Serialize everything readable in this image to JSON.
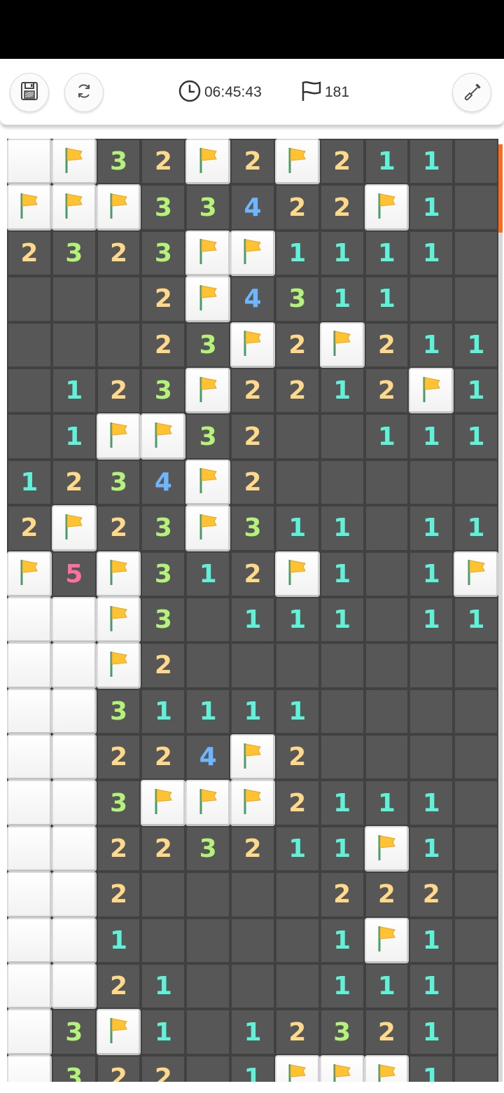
{
  "toolbar": {
    "timer": "06:45:43",
    "flags_remaining": "181",
    "icons": {
      "save": "floppy-disk-icon",
      "restart": "refresh-icon",
      "dig": "shovel-icon",
      "timer": "clock-icon",
      "flags": "flag-outline-icon"
    }
  },
  "board": {
    "legend": "C = covered, F = flagged, . = revealed empty, 1-5 = revealed number",
    "rows": [
      [
        "C",
        "F",
        "3",
        "2",
        "F",
        "2",
        "F",
        "2",
        "1",
        "1",
        "."
      ],
      [
        "F",
        "F",
        "F",
        "3",
        "3",
        "4",
        "2",
        "2",
        "F",
        "1",
        "."
      ],
      [
        "2",
        "3",
        "2",
        "3",
        "F",
        "F",
        "1",
        "1",
        "1",
        "1",
        "."
      ],
      [
        ".",
        ".",
        ".",
        "2",
        "F",
        "4",
        "3",
        "1",
        "1",
        ".",
        "."
      ],
      [
        ".",
        ".",
        ".",
        "2",
        "3",
        "F",
        "2",
        "F",
        "2",
        "1",
        "1"
      ],
      [
        ".",
        "1",
        "2",
        "3",
        "F",
        "2",
        "2",
        "1",
        "2",
        "F",
        "1"
      ],
      [
        ".",
        "1",
        "F",
        "F",
        "3",
        "2",
        ".",
        ".",
        "1",
        "1",
        "1"
      ],
      [
        "1",
        "2",
        "3",
        "4",
        "F",
        "2",
        ".",
        ".",
        ".",
        ".",
        "."
      ],
      [
        "2",
        "F",
        "2",
        "3",
        "F",
        "3",
        "1",
        "1",
        ".",
        "1",
        "1"
      ],
      [
        "F",
        "5",
        "F",
        "3",
        "1",
        "2",
        "F",
        "1",
        ".",
        "1",
        "F"
      ],
      [
        "C",
        "C",
        "F",
        "3",
        ".",
        "1",
        "1",
        "1",
        ".",
        "1",
        "1"
      ],
      [
        "C",
        "C",
        "F",
        "2",
        ".",
        ".",
        ".",
        ".",
        ".",
        ".",
        "."
      ],
      [
        "C",
        "C",
        "3",
        "1",
        "1",
        "1",
        "1",
        ".",
        ".",
        ".",
        "."
      ],
      [
        "C",
        "C",
        "2",
        "2",
        "4",
        "F",
        "2",
        ".",
        ".",
        ".",
        "."
      ],
      [
        "C",
        "C",
        "3",
        "F",
        "F",
        "F",
        "2",
        "1",
        "1",
        "1",
        "."
      ],
      [
        "C",
        "C",
        "2",
        "2",
        "3",
        "2",
        "1",
        "1",
        "F",
        "1",
        "."
      ],
      [
        "C",
        "C",
        "2",
        ".",
        ".",
        ".",
        ".",
        "2",
        "2",
        "2",
        "."
      ],
      [
        "C",
        "C",
        "1",
        ".",
        ".",
        ".",
        ".",
        "1",
        "F",
        "1",
        "."
      ],
      [
        "C",
        "C",
        "2",
        "1",
        ".",
        ".",
        ".",
        "1",
        "1",
        "1",
        "."
      ],
      [
        "C",
        "3",
        "F",
        "1",
        ".",
        "1",
        "2",
        "3",
        "2",
        "1",
        "."
      ],
      [
        "C",
        "3",
        "2",
        "2",
        ".",
        "1",
        "F",
        "F",
        "F",
        "1",
        "."
      ]
    ]
  },
  "colors": {
    "n1": "#5ff2d8",
    "n2": "#ffd98a",
    "n3": "#b4f27a",
    "n4": "#6fb6ff",
    "n5": "#ff6f9f",
    "flag": "#ffc233",
    "scroll_thumb": "#ff6a1a"
  }
}
